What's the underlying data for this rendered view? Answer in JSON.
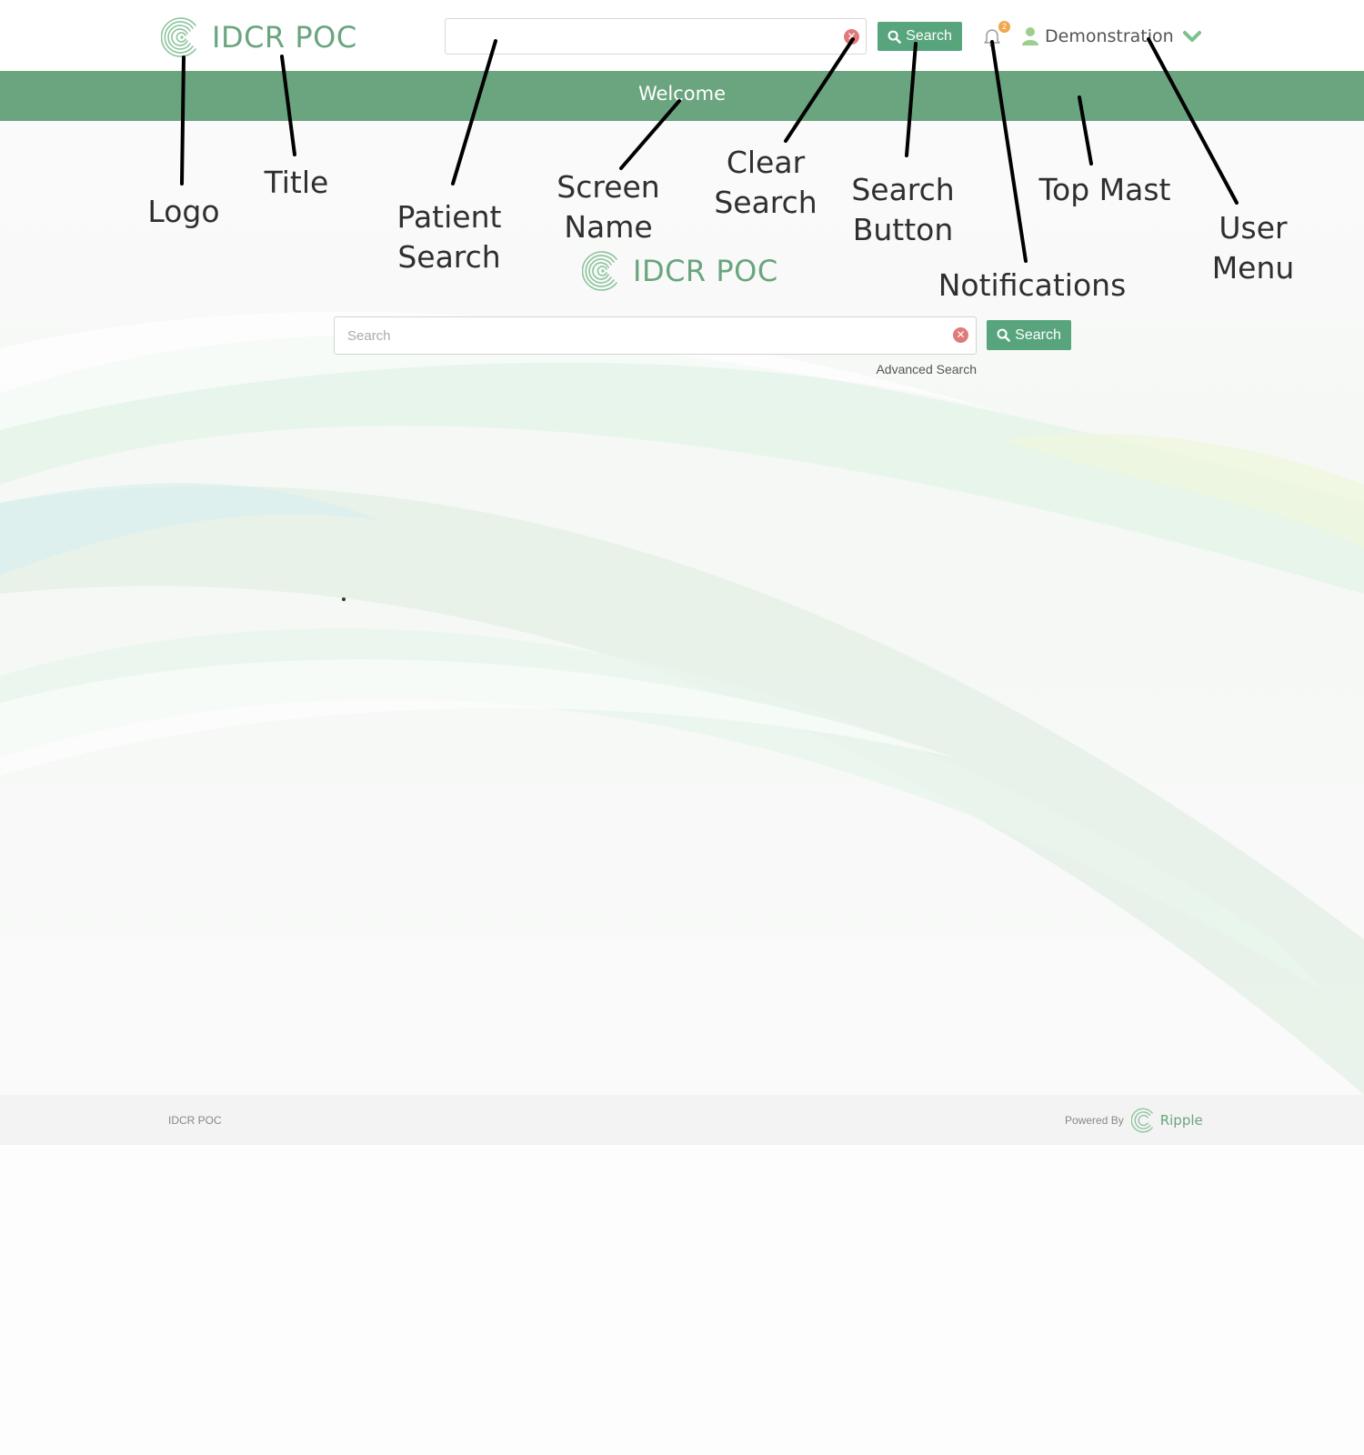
{
  "header": {
    "app_title": "IDCR POC",
    "search": {
      "value": "",
      "placeholder": ""
    },
    "search_button_label": "Search",
    "notifications": {
      "count": "2"
    },
    "user_menu": {
      "name": "Demonstration"
    }
  },
  "mast": {
    "screen_name": "Welcome"
  },
  "main": {
    "brand_title": "IDCR POC",
    "search": {
      "value": "",
      "placeholder": "Search"
    },
    "search_button_label": "Search",
    "advanced_search_label": "Advanced Search"
  },
  "footer": {
    "app_name": "IDCR POC",
    "powered_by": "Powered By",
    "powered_by_name": "Ripple"
  },
  "annotations": {
    "logo": "Logo",
    "title": "Title",
    "patient_search": [
      "Patient",
      "Search"
    ],
    "screen_name": [
      "Screen",
      "Name"
    ],
    "clear_search": [
      "Clear",
      "Search"
    ],
    "search_button": [
      "Search",
      "Button"
    ],
    "top_mast": "Top Mast",
    "notifications": "Notifications",
    "user_menu": [
      "User",
      "Menu"
    ]
  },
  "colors": {
    "brand_green": "#6aa57f",
    "button_green": "#58a57d",
    "clear_red": "#e07a7a",
    "badge_orange": "#f2a64b"
  },
  "icons": {
    "logo": "concentric-c-logo-icon",
    "clear": "close-circle-icon",
    "search": "magnifier-icon",
    "notifications": "bell-icon",
    "user": "user-icon",
    "user_menu_toggle": "chevron-down-icon",
    "ripple": "ripple-logo-icon"
  }
}
